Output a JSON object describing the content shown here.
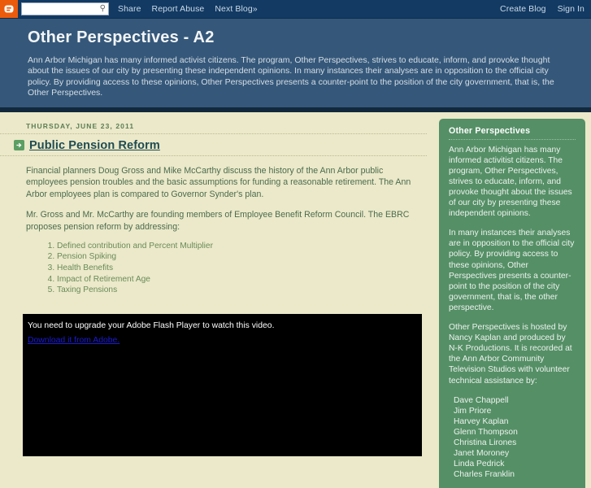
{
  "navbar": {
    "logo_icon": "blogger-b-icon",
    "search": {
      "value": "",
      "placeholder": "",
      "icon": "search-icon"
    },
    "links": [
      "Share",
      "Report Abuse",
      "Next Blog»"
    ],
    "right_links": [
      "Create Blog",
      "Sign In"
    ]
  },
  "header": {
    "title": "Other Perspectives - A2",
    "description": "Ann Arbor Michigan has many informed activist citizens. The program, Other Perspectives, strives to educate, inform, and provoke thought about the issues of our city by presenting these independent opinions. In many instances their analyses are in opposition to the official city policy. By providing access to these opinions, Other Perspectives presents a counter-point to the position of the city government, that is, the Other Perspectives."
  },
  "post": {
    "date": "THURSDAY, JUNE 23, 2011",
    "title": "Public Pension Reform",
    "title_icon": "green-arrow-icon",
    "paragraph1": "Financial planners Doug Gross and Mike McCarthy discuss the history of the Ann Arbor public employees pension troubles and the basic assumptions for funding a reasonable retirement. The Ann Arbor employees plan is compared to Governor Synder's plan.",
    "paragraph2": "Mr. Gross and Mr. McCarthy are founding members of Employee Benefit Reform Council.  The EBRC proposes pension reform by addressing:",
    "list": [
      "Defined contribution and Percent Multiplier",
      "Pension Spiking",
      "Health Benefits",
      "Impact of Retirement Age",
      "Taxing Pensions"
    ]
  },
  "flash": {
    "message": "You need to upgrade your Adobe Flash Player to watch this video.",
    "link_label": "Download it from Adobe."
  },
  "sidebar": {
    "title": "Other Perspectives",
    "paragraph1": "Ann Arbor Michigan has many informed activitist citizens. The program, Other Perspectives, strives to educate, inform, and provoke thought about the issues of our city by presenting these independent opinions.",
    "paragraph2": "In many instances their analyses are in opposition to the official city policy. By providing access to these opinions, Other Perspectives presents a counter-point to the position of the city government, that is, the other perspective.",
    "paragraph3": "Other Perspectives is hosted by Nancy Kaplan and produced by N-K Productions. It is recorded at the Ann Arbor Community Television Studios with volunteer technical assistance by:",
    "names": [
      "Dave Chappell",
      "Jim Priore",
      "Harvey Kaplan",
      "Glenn Thompson",
      "Christina Lirones",
      "Janet Moroney",
      "Linda Pedrick",
      "Charles Franklin"
    ]
  },
  "colors": {
    "navbar_bg": "#123a63",
    "header_bg": "#35587a",
    "header_rule": "#12283c",
    "content_bg": "#ebe9c9",
    "sidebar_bg": "#558f66",
    "accent_orange": "#ec5b0c",
    "post_title": "#1e4b52",
    "link_blue": "#1b1bd4"
  }
}
